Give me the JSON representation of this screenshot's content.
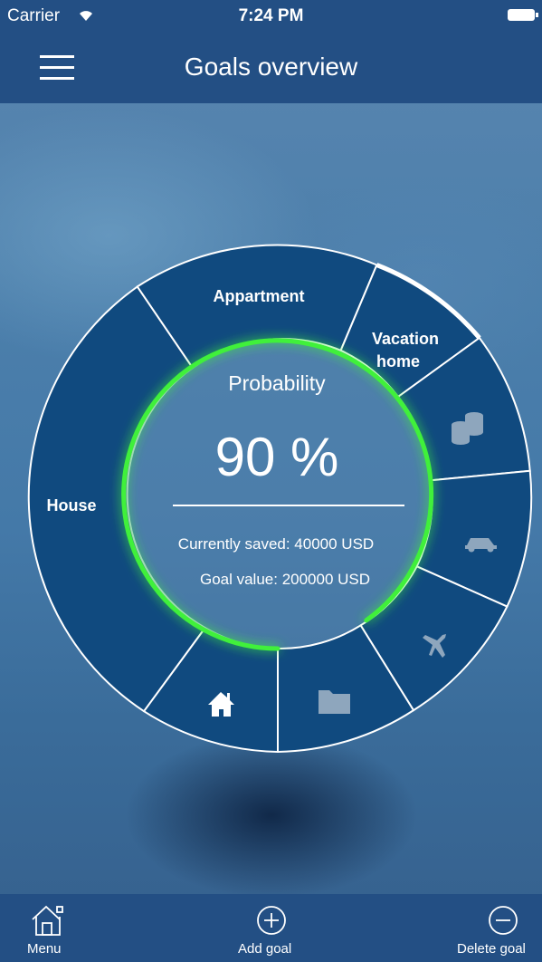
{
  "status_bar": {
    "carrier": "Carrier",
    "time": "7:24 PM"
  },
  "nav": {
    "title": "Goals overview"
  },
  "goals": {
    "segments": [
      {
        "label": "Appartment"
      },
      {
        "label_line1": "Vacation",
        "label_line2": "home"
      },
      {
        "label": "House"
      }
    ],
    "category_icons": [
      "coins-icon",
      "car-icon",
      "airplane-icon",
      "folder-icon",
      "house-icon"
    ]
  },
  "summary": {
    "probability_label": "Probability",
    "probability_value": "90 %",
    "probability_fraction": 0.9,
    "saved_text": "Currently saved: 40000 USD",
    "goal_value_text": "Goal value: 200000 USD"
  },
  "tab_bar": {
    "menu_label": "Menu",
    "add_label": "Add goal",
    "delete_label": "Delete goal"
  },
  "colors": {
    "bar_background": "#234f84",
    "segment_fill": "#104a7f",
    "progress_glow": "#3ff03a"
  }
}
